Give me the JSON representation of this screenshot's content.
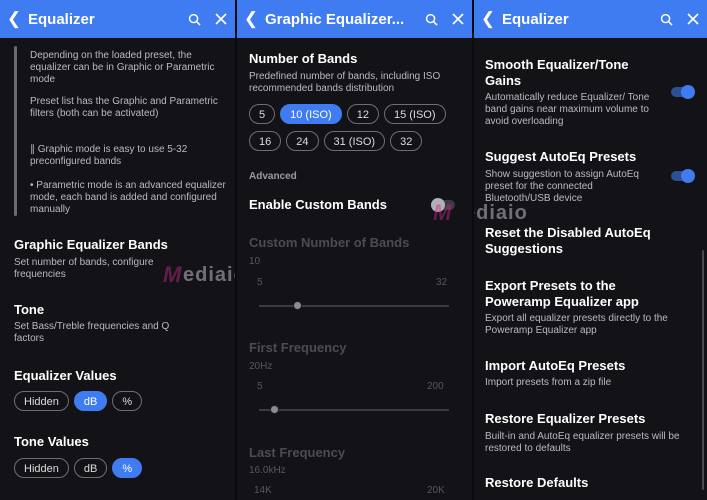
{
  "colors": {
    "accent": "#3f7cf1",
    "panel_bg": "#131317",
    "text_secondary": "#b9b9c2"
  },
  "panel1": {
    "title": "Equalizer",
    "notes": [
      "Depending on the loaded preset, the equalizer can be in Graphic or Parametric mode",
      "Preset list has the Graphic and Parametric filters (both can be activated)",
      "∥ Graphic mode is easy to use 5-32 preconfigured bands",
      "• Parametric mode is an advanced equalizer mode, each band is added and configured manually"
    ],
    "graphic_bands": {
      "title": "Graphic Equalizer Bands",
      "subtitle": "Set number of bands, configure frequencies"
    },
    "tone": {
      "title": "Tone",
      "subtitle": "Set Bass/Treble frequencies and Q factors"
    },
    "eq_values": {
      "title": "Equalizer Values",
      "options": [
        "Hidden",
        "dB",
        "%"
      ],
      "selected": "dB"
    },
    "tone_values": {
      "title": "Tone Values",
      "options": [
        "Hidden",
        "dB",
        "%"
      ],
      "selected": "%"
    }
  },
  "panel2": {
    "title": "Graphic Equalizer...",
    "number_of_bands": {
      "title": "Number of Bands",
      "subtitle": "Predefined number of bands, including ISO recommended bands distribution"
    },
    "band_options_row1": [
      "5",
      "10 (ISO)",
      "12",
      "15 (ISO)"
    ],
    "band_options_row2": [
      "16",
      "24",
      "31 (ISO)",
      "32"
    ],
    "selected_band": "10 (ISO)",
    "advanced_label": "Advanced",
    "enable_custom": {
      "title": "Enable Custom Bands",
      "enabled": false
    },
    "custom_number": {
      "title": "Custom Number of Bands",
      "value": "10",
      "min": "5",
      "max": "32",
      "fraction": 0.2
    },
    "first_frequency": {
      "title": "First Frequency",
      "value": "20Hz",
      "min": "5",
      "max": "200",
      "fraction": 0.08
    },
    "last_frequency": {
      "title": "Last Frequency",
      "value": "16.0kHz",
      "min": "14K",
      "max": "20K"
    }
  },
  "panel3": {
    "title": "Equalizer",
    "smooth": {
      "title": "Smooth Equalizer/Tone Gains",
      "subtitle": "Automatically reduce Equalizer/ Tone band gains near maximum volume to avoid overloading",
      "enabled": true
    },
    "suggest": {
      "title": "Suggest AutoEq Presets",
      "subtitle": "Show suggestion to assign AutoEq preset for the connected Bluetooth/USB device",
      "enabled": true
    },
    "reset": {
      "title": "Reset the Disabled AutoEq Suggestions"
    },
    "export": {
      "title": "Export Presets to the Poweramp Equalizer app",
      "subtitle": "Export all equalizer presets directly to the Poweramp Equalizer app"
    },
    "import": {
      "title": "Import AutoEq Presets",
      "subtitle": "Import presets from a zip file"
    },
    "restore": {
      "title": "Restore Equalizer Presets",
      "subtitle": "Built-in and AutoEq equalizer presets will be restored to defaults"
    },
    "restore_defaults": {
      "title": "Restore Defaults"
    }
  },
  "watermark": {
    "letter": "M",
    "text": "ediaio"
  }
}
